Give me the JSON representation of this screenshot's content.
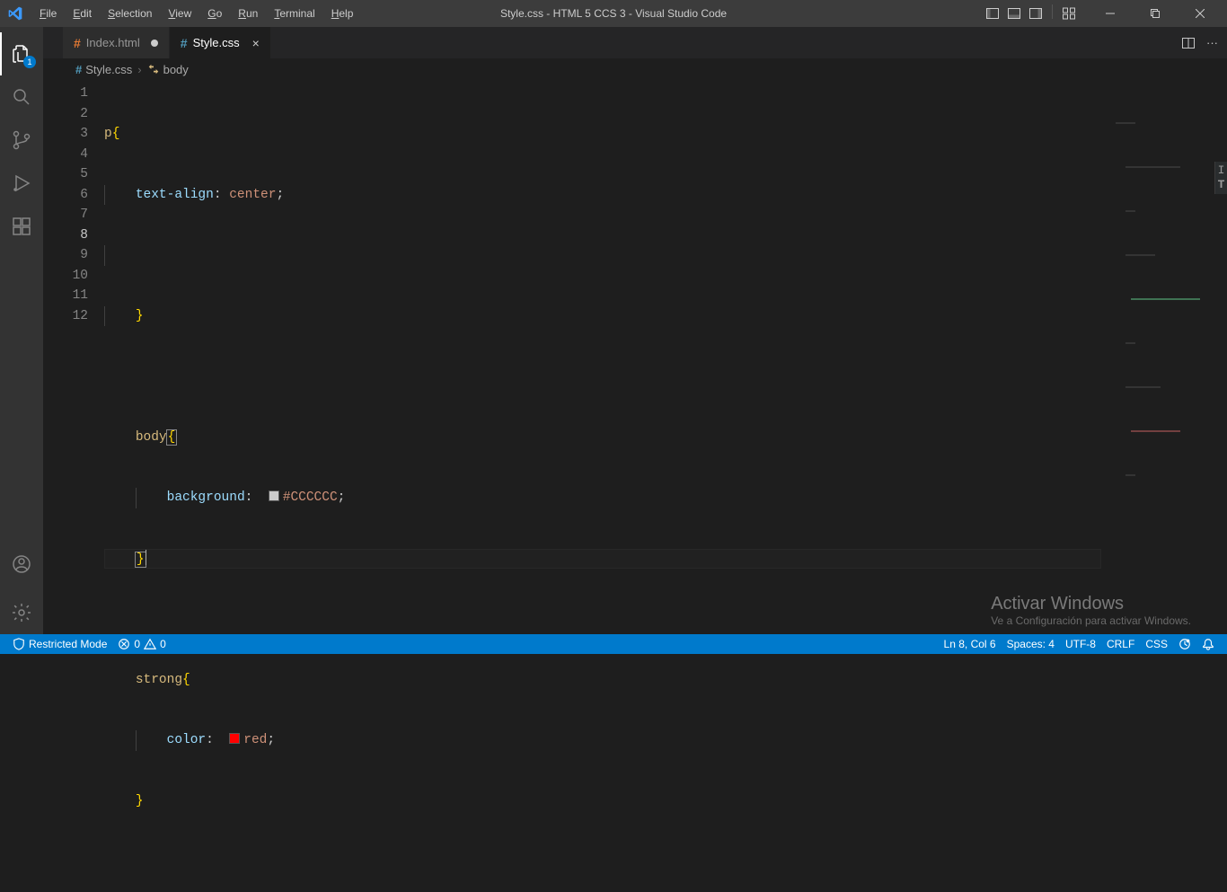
{
  "title": "Style.css - HTML 5 CCS 3 - Visual Studio Code",
  "menu": {
    "file": "File",
    "edit": "Edit",
    "selection": "Selection",
    "view": "View",
    "go": "Go",
    "run": "Run",
    "terminal": "Terminal",
    "help": "Help"
  },
  "activity": {
    "explorer_badge": "1"
  },
  "tabs": {
    "tab0": {
      "icon": "#",
      "label": "Index.html",
      "dirty": true
    },
    "tab1": {
      "icon": "#",
      "label": "Style.css",
      "active": true
    }
  },
  "breadcrumb": {
    "file": "Style.css",
    "symbol": "body"
  },
  "code": {
    "line1": {
      "sel": "p"
    },
    "line2": {
      "prop": "text-align",
      "val": "center"
    },
    "line6": {
      "sel": "body"
    },
    "line7": {
      "prop": "background",
      "val": "#CCCCCC",
      "swatch": "#CCCCCC"
    },
    "line10": {
      "sel": "strong"
    },
    "line11": {
      "prop": "color",
      "val": "red",
      "swatch": "#ff0000"
    }
  },
  "gutter": [
    "1",
    "2",
    "3",
    "4",
    "5",
    "6",
    "7",
    "8",
    "9",
    "10",
    "11",
    "12"
  ],
  "current_line_index": 7,
  "statusbar": {
    "restricted": "Restricted Mode",
    "errors": "0",
    "warnings": "0",
    "ln_col": "Ln 8, Col 6",
    "spaces": "Spaces: 4",
    "encoding": "UTF-8",
    "eol": "CRLF",
    "lang": "CSS"
  },
  "watermark": {
    "title": "Activar Windows",
    "sub": "Ve a Configuración para activar Windows."
  },
  "decor": {
    "line1": "I",
    "line2": "T"
  }
}
